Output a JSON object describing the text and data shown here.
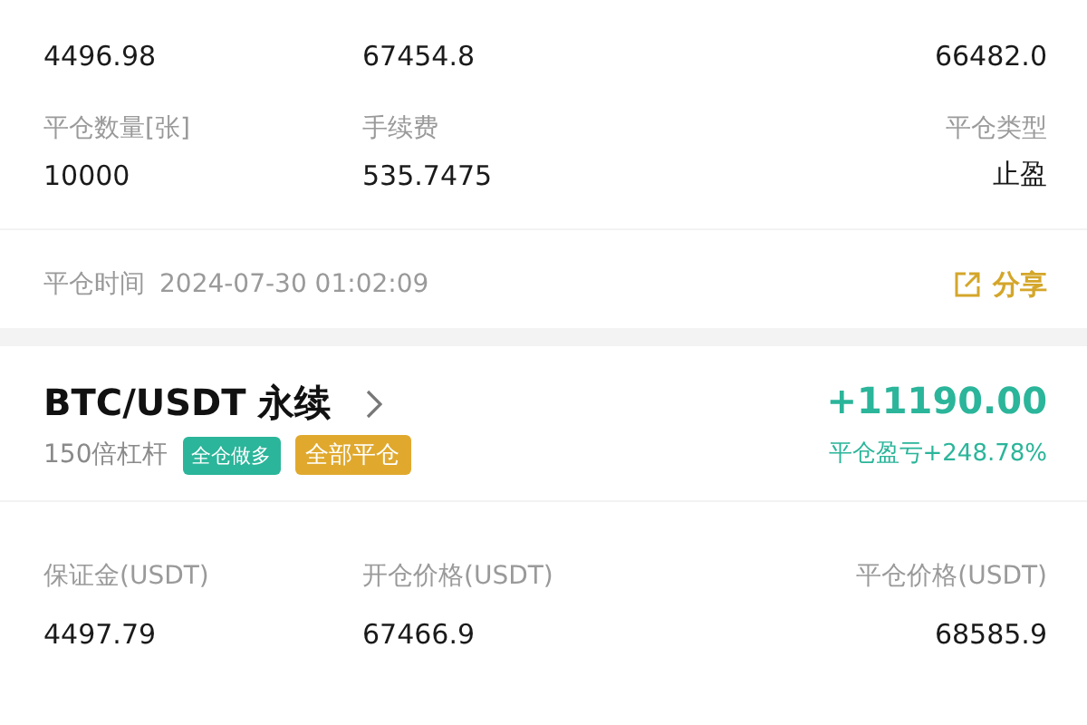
{
  "closed_position": {
    "top_values": [
      "4496.98",
      "67454.8",
      "66482.0"
    ],
    "fields": [
      {
        "label": "平仓数量[张]",
        "value": "10000"
      },
      {
        "label": "手续费",
        "value": "535.7475"
      },
      {
        "label": "平仓类型",
        "value": "止盈"
      }
    ],
    "close_time_label": "平仓时间",
    "close_time": "2024-07-30 01:02:09",
    "share": "分享"
  },
  "position": {
    "symbol": "BTC/USDT 永续",
    "leverage": "150倍杠杆",
    "tags": [
      {
        "label": "全仓做多",
        "color": "#2bb59a"
      },
      {
        "label": "全部平仓",
        "color": "#e0a92e"
      }
    ],
    "pnl": "+11190.00",
    "pnl_ratio": "平仓盈亏+248.78%",
    "fields": [
      {
        "label": "保证金(USDT)",
        "value": "4497.79"
      },
      {
        "label": "开仓价格(USDT)",
        "value": "67466.9"
      },
      {
        "label": "平仓价格(USDT)",
        "value": "68585.9"
      }
    ]
  }
}
